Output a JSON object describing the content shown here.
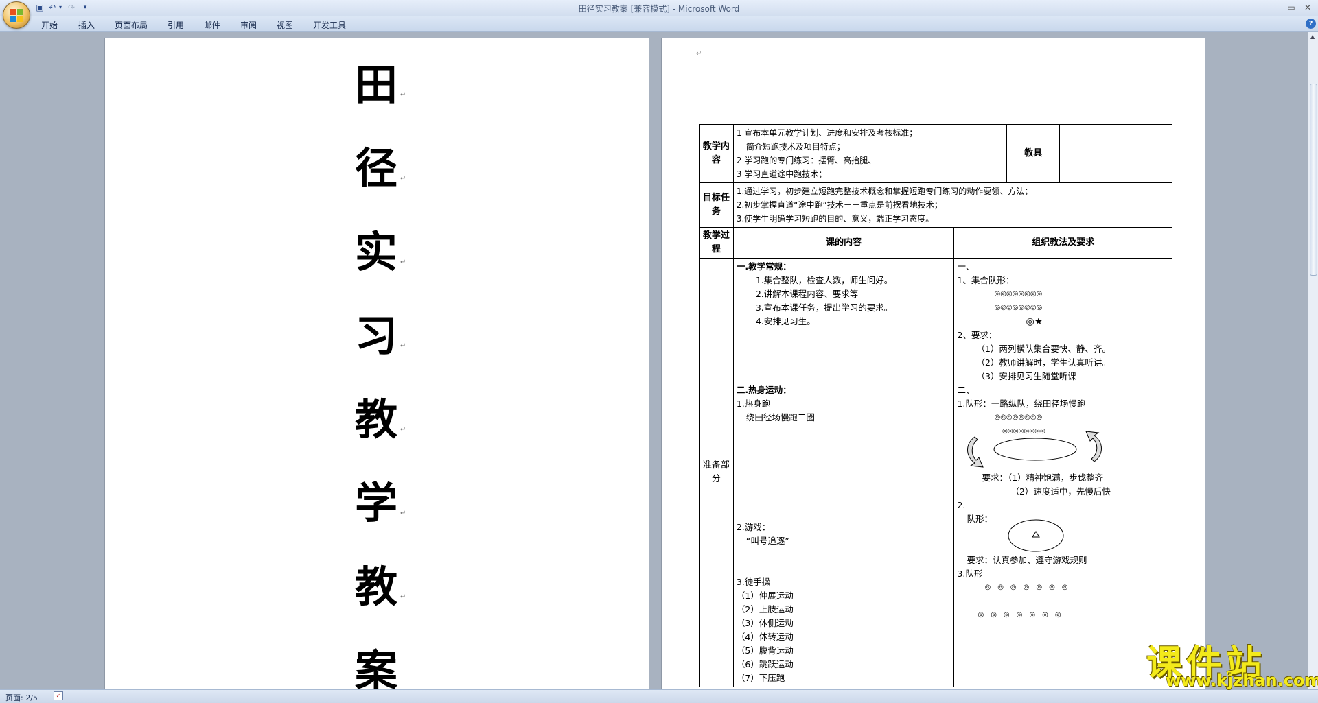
{
  "window": {
    "title": "田径实习教案 [兼容模式] - Microsoft Word"
  },
  "ribbon": {
    "tabs": [
      "开始",
      "插入",
      "页面布局",
      "引用",
      "邮件",
      "审阅",
      "视图",
      "开发工具"
    ]
  },
  "quick_access": {
    "save_icon": "save-icon",
    "undo_icon": "undo-icon",
    "redo_icon": "redo-icon"
  },
  "page1": {
    "title_chars": [
      "田",
      "径",
      "实",
      "习",
      "教",
      "学",
      "教",
      "案"
    ]
  },
  "lesson_table": {
    "content_label": "教学内容",
    "content_lines": [
      "1 宣布本单元教学计划、进度和安排及考核标准；",
      "简介短跑技术及项目特点；",
      "2 学习跑的专门练习：摆臂、高抬腿、",
      "3 学习直道途中跑技术；"
    ],
    "equipment_label": "教具",
    "goals_label": "目标任务",
    "goals_lines": [
      "1.通过学习，初步建立短跑完整技术概念和掌握短跑专门练习的动作要领、方法；",
      "2.初步掌握直道“途中跑”技术－－重点是前摆看地技术；",
      "3.使学生明确学习短跑的目的、意义，端正学习态度。"
    ],
    "process_label": "教学过程",
    "col_content": "课的内容",
    "col_org": "组织教法及要求",
    "prep_label": "准备部分",
    "routine": {
      "heading": "一.教学常规：",
      "items": [
        "1.集合整队，检查人数，师生问好。",
        "2.讲解本课程内容、要求等",
        "3.宣布本课任务，提出学习的要求。",
        "4.安排见习生。"
      ]
    },
    "warmup": {
      "heading": "二.热身运动：",
      "item1": "1.热身跑",
      "item1_detail": "绕田径场慢跑二圈",
      "item2": "2.游戏：",
      "item2_detail": "“叫号追逐”",
      "item3": "3.徒手操",
      "exercises": [
        "（1）伸展运动",
        "（2）上肢运动",
        "（3）体侧运动",
        "（4）体转运动",
        "（5）腹背运动",
        "（6）跳跃运动",
        "（7）下压跑"
      ]
    },
    "org": {
      "s1": "一、",
      "s1_item": "1、集合队形：",
      "formation_row": "◎◎◎◎◎◎◎◎",
      "teacher": "◎★",
      "req_heading": "2、要求：",
      "reqs": [
        "（1）两列横队集合要快、静、齐。",
        "（2）教师讲解时，学生认真听讲。",
        "（3）安排见习生随堂听课"
      ],
      "s2": "二、",
      "s2_item": "1.队形：一路纵队，绕田径场慢跑",
      "run_row": "◎◎◎◎◎◎◎◎",
      "run_reqs": [
        "要求：（1）精神饱满，步伐整齐",
        "（2）速度适中，先慢后快"
      ],
      "s2b": "2.",
      "s2b_form": "队形：",
      "game_req": "要求：认真参加、遵守游戏规则",
      "s3": "3.队形",
      "dots_row": "◎　◎　◎　◎　◎　◎　◎"
    }
  },
  "status": {
    "page": "页面: 2/5"
  },
  "watermark": {
    "brand": "课件站",
    "url": "www.kjzhan.com"
  }
}
